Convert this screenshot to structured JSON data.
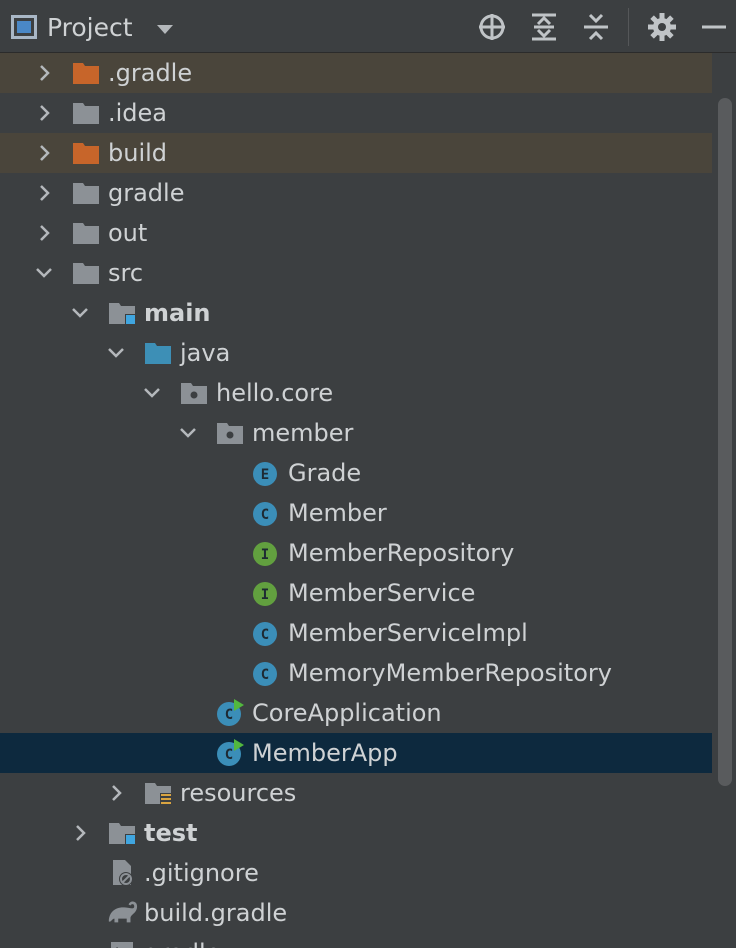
{
  "toolbar": {
    "title": "Project",
    "icons": [
      "locate-icon",
      "expand-all-icon",
      "collapse-all-icon",
      "gear-icon",
      "minimize-icon"
    ]
  },
  "colors": {
    "folder_gray": "#8c9196",
    "folder_excluded": "#c7652a",
    "source_root": "#3d8fb6",
    "class_badge": "#3b8eb8",
    "interface_badge": "#62a03f",
    "enum_badge": "#3b8eb8",
    "selection": "#0d293e",
    "excluded_row": "#4a453b"
  },
  "tree": [
    {
      "label": ".gradle",
      "level": 0,
      "chevron": "right",
      "icon": "folder-excluded",
      "state": "excluded"
    },
    {
      "label": ".idea",
      "level": 0,
      "chevron": "right",
      "icon": "folder"
    },
    {
      "label": "build",
      "level": 0,
      "chevron": "right",
      "icon": "folder-excluded",
      "state": "excluded"
    },
    {
      "label": "gradle",
      "level": 0,
      "chevron": "right",
      "icon": "folder"
    },
    {
      "label": "out",
      "level": 0,
      "chevron": "right",
      "icon": "folder"
    },
    {
      "label": "src",
      "level": 0,
      "chevron": "down",
      "icon": "folder"
    },
    {
      "label": "main",
      "level": 1,
      "chevron": "down",
      "icon": "module-folder",
      "bold": true
    },
    {
      "label": "java",
      "level": 2,
      "chevron": "down",
      "icon": "source-folder"
    },
    {
      "label": "hello.core",
      "level": 3,
      "chevron": "down",
      "icon": "package"
    },
    {
      "label": "member",
      "level": 4,
      "chevron": "down",
      "icon": "package"
    },
    {
      "label": "Grade",
      "level": 5,
      "chevron": "",
      "icon": "enum",
      "badge": "E"
    },
    {
      "label": "Member",
      "level": 5,
      "chevron": "",
      "icon": "class",
      "badge": "C"
    },
    {
      "label": "MemberRepository",
      "level": 5,
      "chevron": "",
      "icon": "interface",
      "badge": "I"
    },
    {
      "label": "MemberService",
      "level": 5,
      "chevron": "",
      "icon": "interface",
      "badge": "I"
    },
    {
      "label": "MemberServiceImpl",
      "level": 5,
      "chevron": "",
      "icon": "class",
      "badge": "C"
    },
    {
      "label": "MemoryMemberRepository",
      "level": 5,
      "chevron": "",
      "icon": "class",
      "badge": "C"
    },
    {
      "label": "CoreApplication",
      "level": 4,
      "chevron": "",
      "icon": "runnable-class",
      "badge": "C"
    },
    {
      "label": "MemberApp",
      "level": 4,
      "chevron": "",
      "icon": "runnable-class",
      "badge": "C",
      "state": "selected"
    },
    {
      "label": "resources",
      "level": 2,
      "chevron": "right",
      "icon": "resources-folder"
    },
    {
      "label": "test",
      "level": 1,
      "chevron": "right",
      "icon": "module-folder",
      "bold": true
    },
    {
      "label": ".gitignore",
      "level": 1,
      "chevron": "",
      "icon": "ignore-file"
    },
    {
      "label": "build.gradle",
      "level": 1,
      "chevron": "",
      "icon": "gradle-file"
    },
    {
      "label": "gradlew",
      "level": 1,
      "chevron": "",
      "icon": "shell-file"
    }
  ]
}
